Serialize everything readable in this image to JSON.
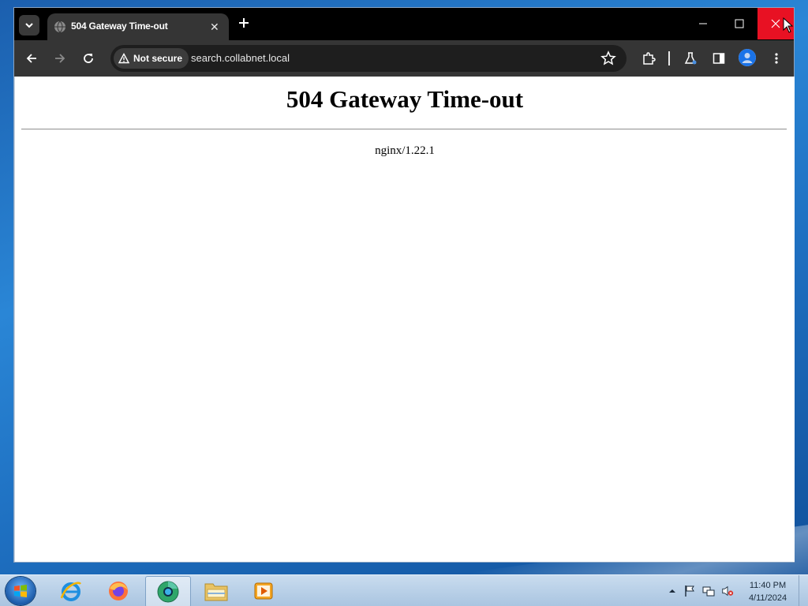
{
  "browser": {
    "tab": {
      "title": "504 Gateway Time-out"
    },
    "omnibox": {
      "security_label": "Not secure",
      "url": "search.collabnet.local"
    }
  },
  "page": {
    "heading": "504 Gateway Time-out",
    "server_signature": "nginx/1.22.1"
  },
  "taskbar": {
    "apps": [
      "internet-explorer",
      "firefox",
      "chrome-browser",
      "file-explorer",
      "media-player"
    ],
    "clock": {
      "time": "11:40 PM",
      "date": "4/11/2024"
    }
  },
  "colors": {
    "close_button": "#e81123",
    "toolbar": "#353535",
    "tabstrip": "#000000"
  }
}
